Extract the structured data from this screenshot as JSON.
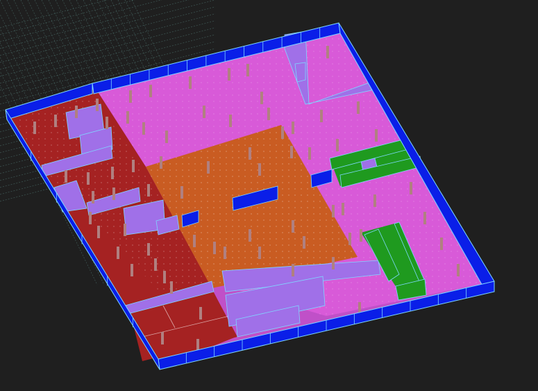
{
  "viewport": {
    "background": "#1f1f1f",
    "view_mode": "3d-isometric",
    "grid_visible": true
  },
  "colors": {
    "grid_line": "#5a8a84",
    "exterior_wall_face": "#0a1ee8",
    "wall_edge": "#7fd8ff",
    "zone_red": "#a52222",
    "zone_pink": "#d85ad8",
    "zone_orange": "#c95c22",
    "zone_green": "#1f9a1f",
    "partition_wall": "#a070e8",
    "column": "#b08080"
  },
  "zones": [
    {
      "id": "red-zone",
      "color": "zone_red"
    },
    {
      "id": "pink-zone",
      "color": "zone_pink"
    },
    {
      "id": "orange-zone",
      "color": "zone_orange"
    },
    {
      "id": "green-zone",
      "color": "zone_green"
    }
  ]
}
